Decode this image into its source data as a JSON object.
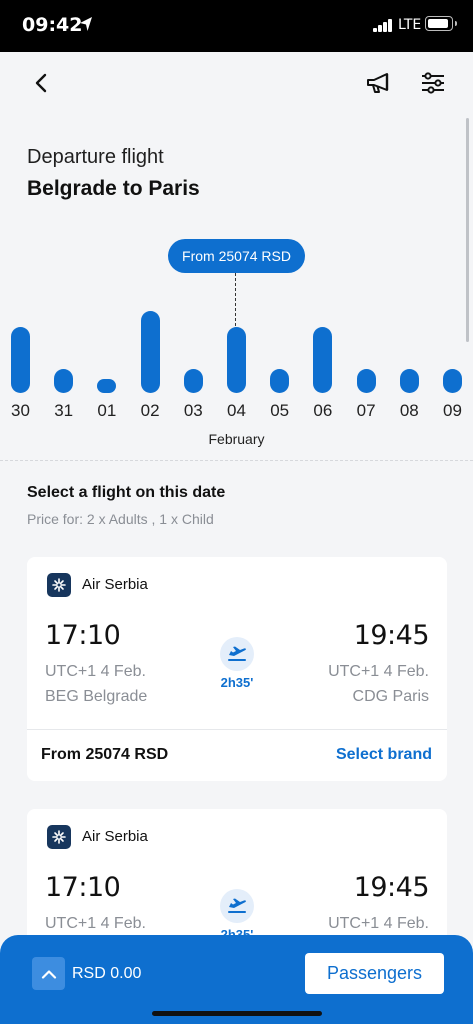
{
  "status_bar": {
    "time": "09:42",
    "network": "LTE",
    "icons": [
      "location-arrow-icon",
      "signal-bars-icon",
      "battery-icon"
    ]
  },
  "app_bar": {
    "icons": [
      "back-chevron-icon",
      "megaphone-icon",
      "filter-sliders-icon"
    ]
  },
  "header": {
    "subtitle": "Departure flight",
    "title": "Belgrade to Paris"
  },
  "date_chart": {
    "selected_price": "From 25074 RSD",
    "month": "February",
    "selected_index": 5,
    "days": [
      {
        "label": "30",
        "level": 3
      },
      {
        "label": "31",
        "level": 1
      },
      {
        "label": "01",
        "level": 0
      },
      {
        "label": "02",
        "level": 4
      },
      {
        "label": "03",
        "level": 1
      },
      {
        "label": "04",
        "level": 3
      },
      {
        "label": "05",
        "level": 1
      },
      {
        "label": "06",
        "level": 3
      },
      {
        "label": "07",
        "level": 1
      },
      {
        "label": "08",
        "level": 1
      },
      {
        "label": "09",
        "level": 1
      }
    ]
  },
  "flights_section": {
    "title": "Select a flight on this date",
    "subtitle": "Price for: 2 x Adults , 1 x Child"
  },
  "flights": [
    {
      "airline": "Air Serbia",
      "dep_time": "17:10",
      "dep_date": "UTC+1 4 Feb.",
      "dep_airport": "BEG Belgrade",
      "arr_time": "19:45",
      "arr_date": "UTC+1 4 Feb.",
      "arr_airport": "CDG Paris",
      "duration": "2h35'",
      "price": "From 25074 RSD",
      "action": "Select brand"
    },
    {
      "airline": "Air Serbia",
      "dep_time": "17:10",
      "dep_date": "UTC+1 4 Feb.",
      "arr_time": "19:45",
      "arr_date": "UTC+1 4 Feb.",
      "duration": "2h35'"
    }
  ],
  "bottom_bar": {
    "total": "RSD 0.00",
    "passengers_label": "Passengers"
  },
  "colors": {
    "accent": "#0e6fcf",
    "background": "#f4f5f7",
    "card": "#ffffff",
    "muted_text": "#8a8e95",
    "airline_logo": "#17365d"
  }
}
